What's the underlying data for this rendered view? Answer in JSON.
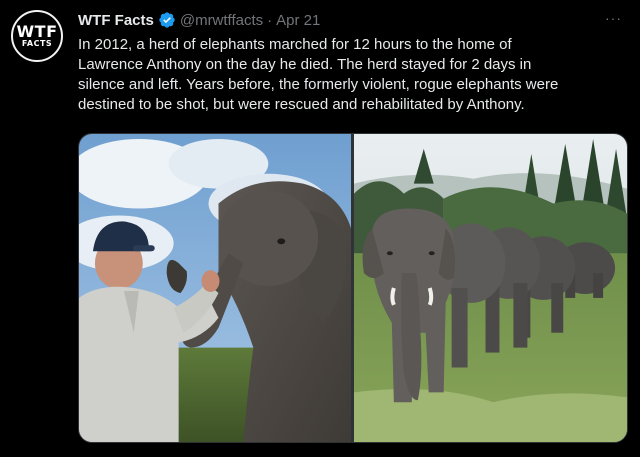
{
  "tweet": {
    "avatar": {
      "line1": "WTF",
      "line2": "FACTS"
    },
    "author_name": "WTF Facts",
    "handle": "@mrwtffacts",
    "separator": "·",
    "date": "Apr 21",
    "more": "···",
    "text_lines": [
      "In 2012, a herd of elephants marched for 12 hours to the home of",
      "Lawrence Anthony on the day he died. The herd stayed for 2 days in",
      "silence and left. Years before, the formerly violent, rogue elephants were",
      "destined to be shot, but were rescued and rehabilitated by Anthony."
    ]
  },
  "icons": {
    "verified": "verified-badge-icon",
    "more": "more-options-icon"
  },
  "colors": {
    "background": "#000000",
    "text": "#e7e9ea",
    "secondary": "#71767b",
    "verified": "#1d9bf0"
  }
}
